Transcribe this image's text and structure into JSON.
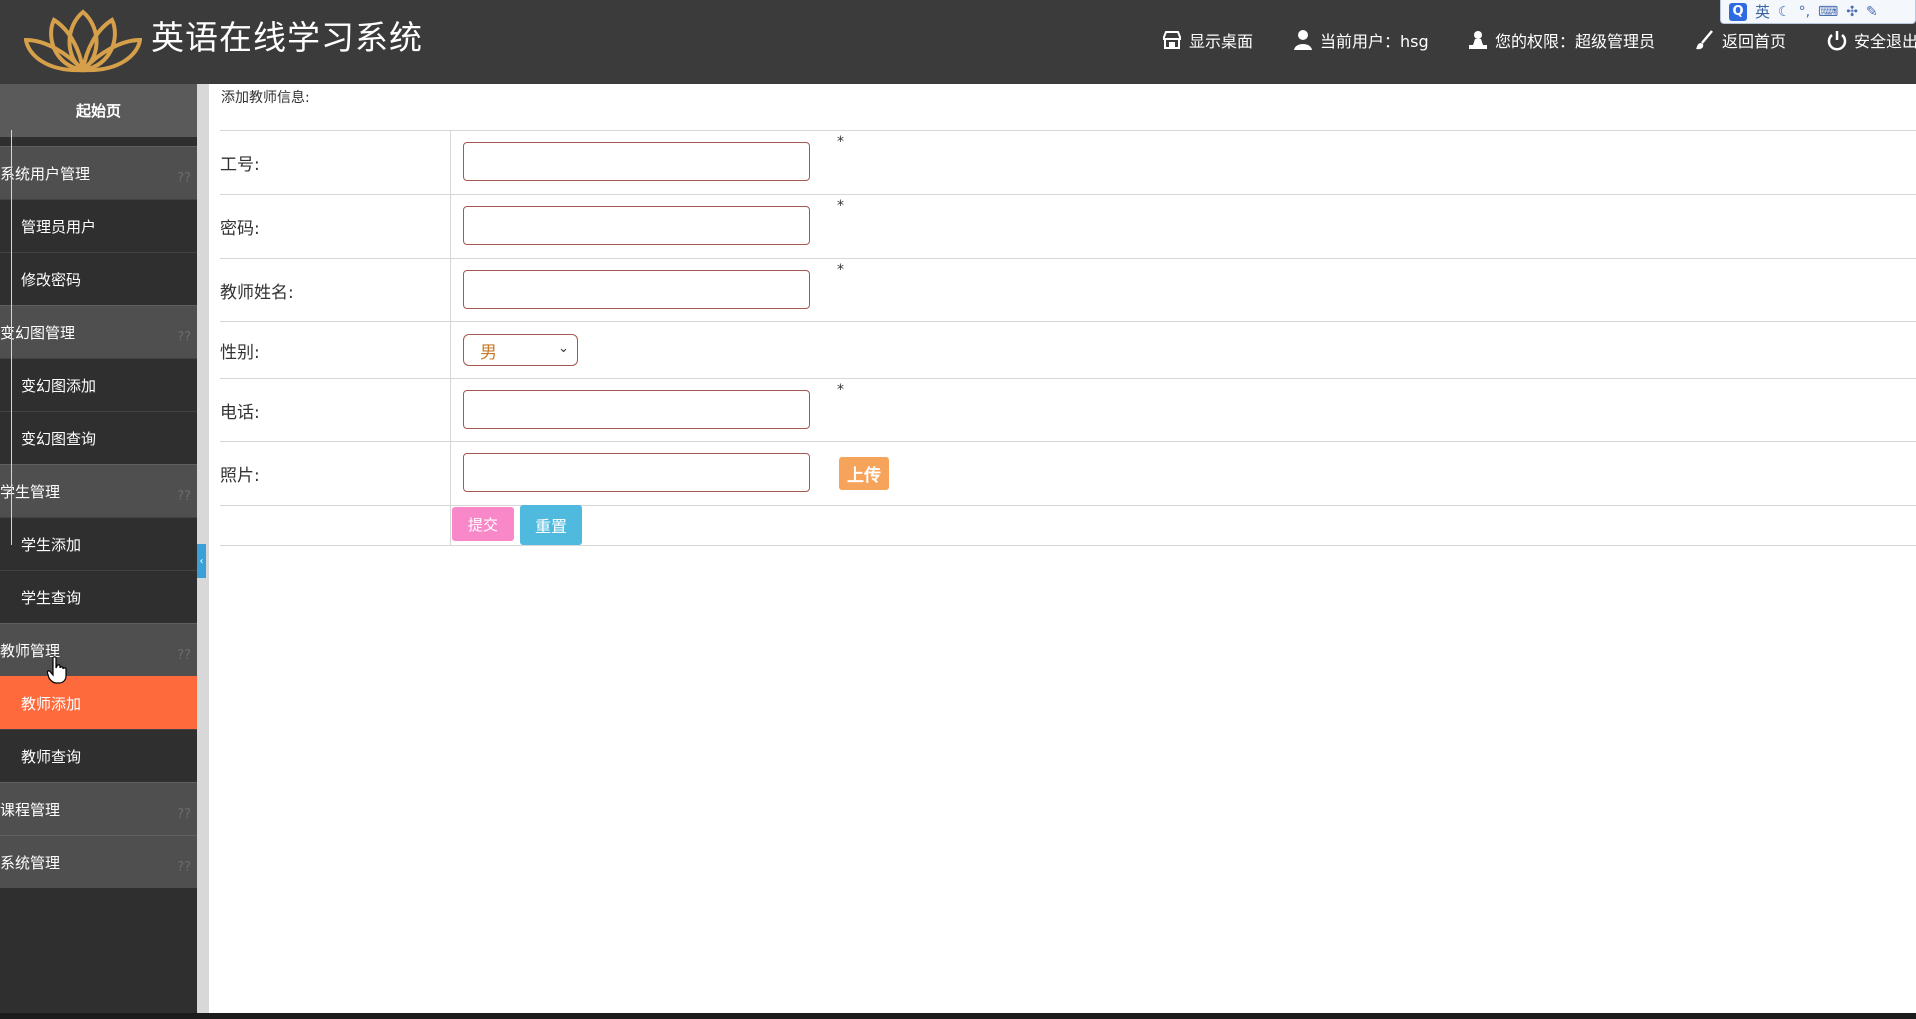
{
  "header": {
    "app_title": "英语在线学习系统",
    "show_desktop": "显示桌面",
    "current_user_label": "当前用户：hsg",
    "permission_label": "您的权限：超级管理员",
    "back_home": "返回首页",
    "logout": "安全退出"
  },
  "ime": {
    "lang": "英",
    "icons": [
      "q-logo-icon",
      "moon-icon",
      "punctuation-icon",
      "keyboard-icon",
      "tools-icon",
      "wrench-icon"
    ]
  },
  "sidebar": {
    "home": "起始页",
    "groups": [
      {
        "label": "系统用户管理",
        "items": [
          "管理员用户",
          "修改密码"
        ]
      },
      {
        "label": "变幻图管理",
        "items": [
          "变幻图添加",
          "变幻图查询"
        ]
      },
      {
        "label": "学生管理",
        "items": [
          "学生添加",
          "学生查询"
        ]
      },
      {
        "label": "教师管理",
        "items": [
          "教师添加",
          "教师查询"
        ]
      },
      {
        "label": "课程管理",
        "items": []
      },
      {
        "label": "系统管理",
        "items": []
      }
    ],
    "active_item": "教师添加",
    "collapse_marker": "??"
  },
  "main": {
    "breadcrumb": "添加教师信息:",
    "fields": [
      {
        "label": "工号:",
        "value": "",
        "required": "*"
      },
      {
        "label": "密码:",
        "value": "",
        "required": "*"
      },
      {
        "label": "教师姓名:",
        "value": "",
        "required": "*"
      },
      {
        "label": "性别:",
        "value": "男"
      },
      {
        "label": "电话:",
        "value": "",
        "required": "*"
      },
      {
        "label": "照片:",
        "value": ""
      }
    ],
    "upload_label": "上传",
    "submit_label": "提交",
    "reset_label": "重置"
  }
}
